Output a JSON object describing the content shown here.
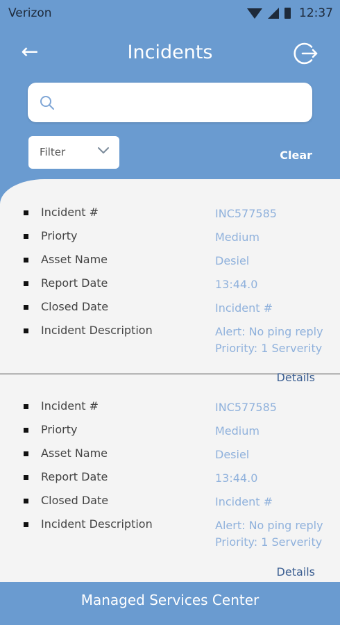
{
  "status_bar": {
    "carrier": "Verizon",
    "time": "12:37"
  },
  "header": {
    "title": "Incidents",
    "back_icon": "arrow-left-icon",
    "logout_icon": "logout-icon"
  },
  "search": {
    "placeholder": "",
    "value": "",
    "icon": "search-icon"
  },
  "filter": {
    "selected": "Filter"
  },
  "clear_label": "Clear",
  "incidents": [
    {
      "fields": [
        {
          "label": "Incident #",
          "value": "INC577585"
        },
        {
          "label": "Priorty",
          "value": "Medium"
        },
        {
          "label": "Asset Name",
          "value": "Desiel"
        },
        {
          "label": "Report Date",
          "value": "13:44.0"
        },
        {
          "label": "Closed Date",
          "value": "Incident #"
        },
        {
          "label": "Incident Description",
          "value": "Alert: No ping reply",
          "value_line2": "Priority: 1 Serverity"
        }
      ],
      "details_label": "Details"
    },
    {
      "fields": [
        {
          "label": "Incident #",
          "value": "INC577585"
        },
        {
          "label": "Priorty",
          "value": "Medium"
        },
        {
          "label": "Asset Name",
          "value": "Desiel"
        },
        {
          "label": "Report Date",
          "value": "13:44.0"
        },
        {
          "label": "Closed Date",
          "value": "Incident #"
        },
        {
          "label": "Incident Description",
          "value": "Alert: No ping reply",
          "value_line2": "Priority: 1 Serverity"
        }
      ],
      "details_label": "Details"
    }
  ],
  "footer": {
    "title": "Managed Services Center"
  },
  "colors": {
    "primary": "#6a9bd0",
    "panel": "#f4f4f4",
    "value_text": "#8fb1dc",
    "link": "#3c5f92"
  }
}
